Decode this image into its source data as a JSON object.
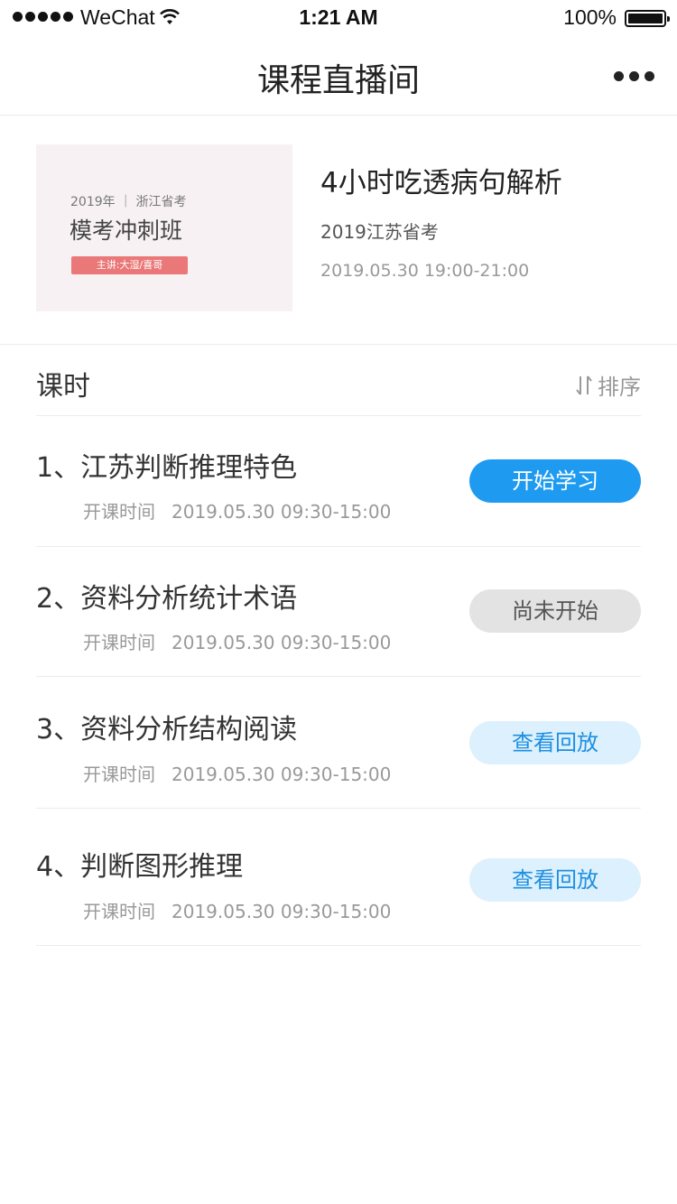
{
  "status_bar": {
    "carrier": "WeChat",
    "time": "1:21 AM",
    "battery": "100%"
  },
  "nav": {
    "title": "课程直播间"
  },
  "course": {
    "cover": {
      "subtitle": "2019年 ｜ 浙江省考",
      "title": "模考冲刺班",
      "badge": "主讲:大湿/喜哥"
    },
    "title": "4小时吃透病句解析",
    "exam": "2019江苏省考",
    "datetime": "2019.05.30   19:00-21:00"
  },
  "section": {
    "title": "课时",
    "sort_label": "排序"
  },
  "lessons": [
    {
      "title": "1、江苏判断推理特色",
      "time_label": "开课时间",
      "time": "2019.05.30   09:30-15:00",
      "action": "开始学习"
    },
    {
      "title": "2、资料分析统计术语",
      "time_label": "开课时间",
      "time": "2019.05.30   09:30-15:00",
      "action": "尚未开始"
    },
    {
      "title": "3、资料分析结构阅读",
      "time_label": "开课时间",
      "time": "2019.05.30   09:30-15:00",
      "action": "查看回放"
    },
    {
      "title": "4、判断图形推理",
      "time_label": "开课时间",
      "time": "2019.05.30   09:30-15:00",
      "action": "查看回放"
    }
  ],
  "colors": {
    "primary": "#1e9bf0",
    "disabled": "#e3e3e3",
    "replay_bg": "#dcf0fd",
    "badge": "#ea7878"
  },
  "icons": {
    "more": "more-dots-icon",
    "sort": "sort-arrows-icon",
    "wifi": "wifi-icon",
    "battery": "battery-icon",
    "signal": "signal-dots-icon"
  }
}
